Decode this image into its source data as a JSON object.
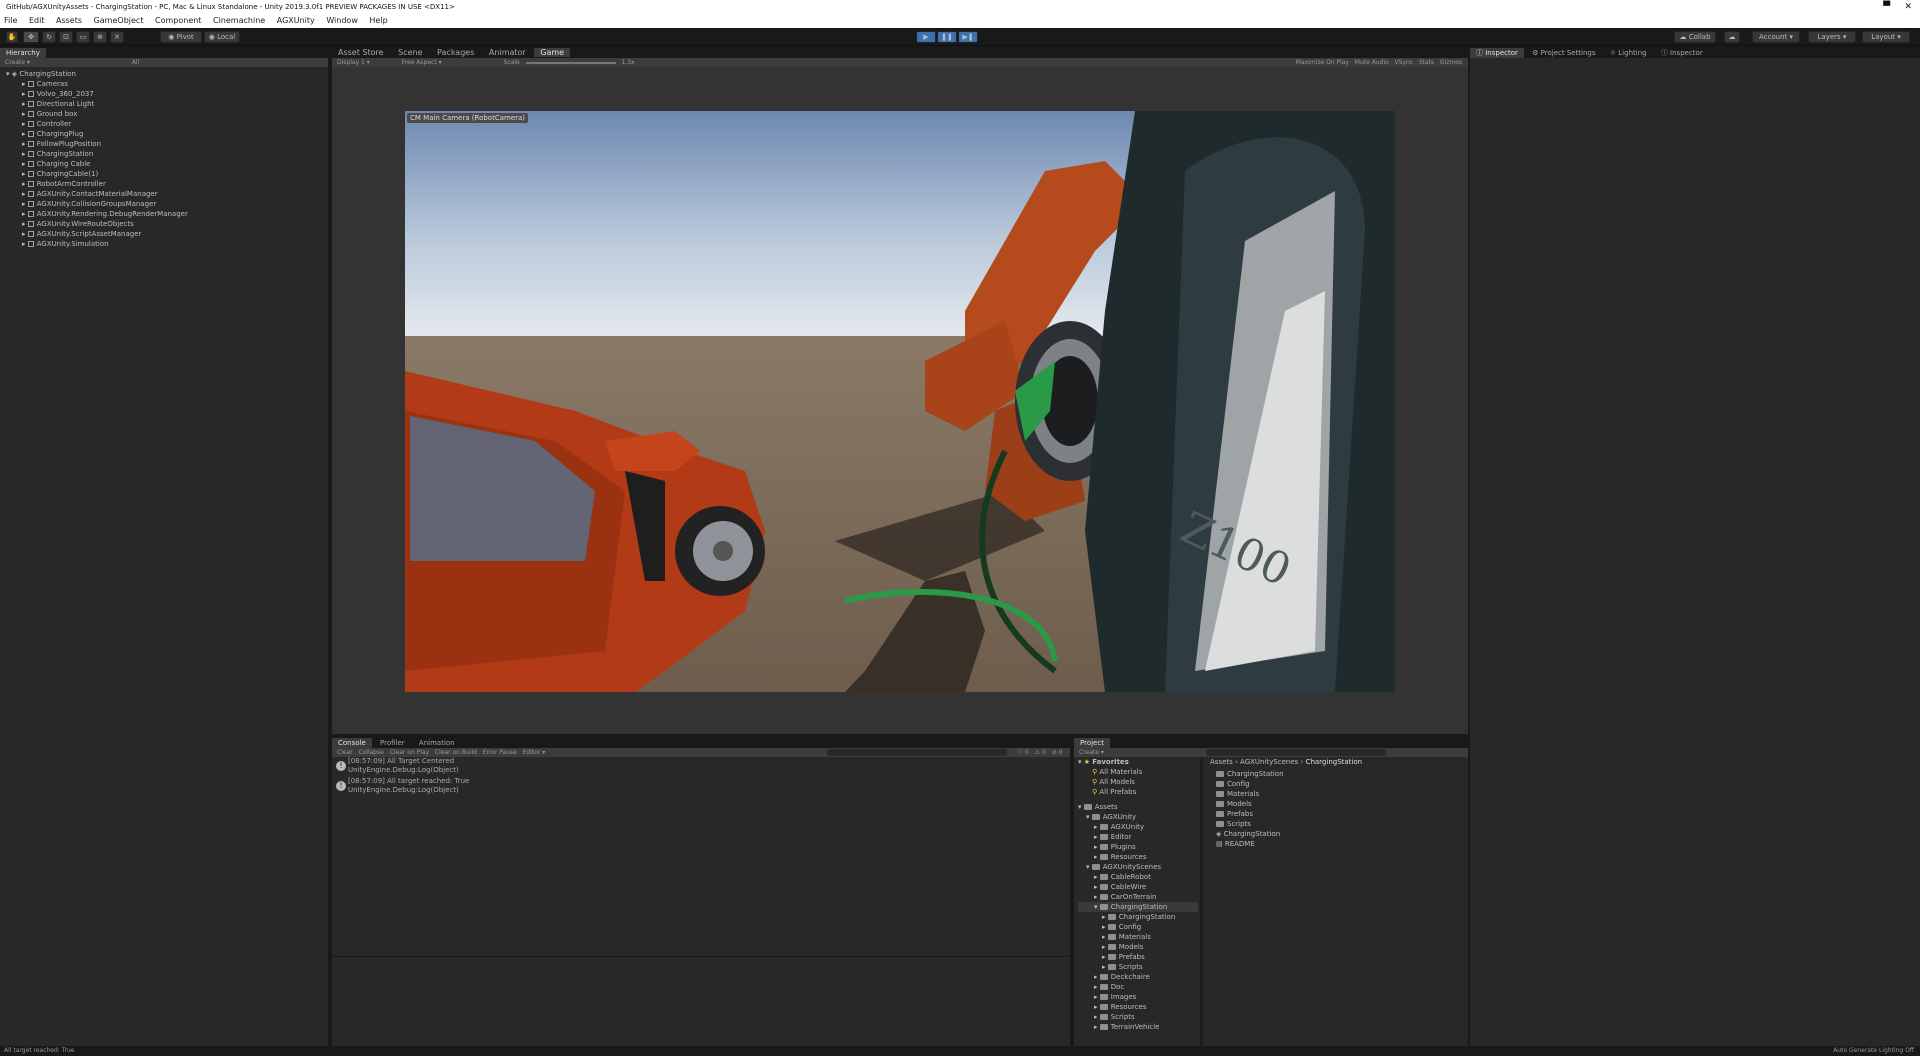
{
  "window": {
    "title": "GitHub/AGXUnityAssets - ChargingStation - PC, Mac & Linux Standalone - Unity 2019.3.0f1 PREVIEW PACKAGES IN USE <DX11>"
  },
  "menu": [
    "File",
    "Edit",
    "Assets",
    "GameObject",
    "Component",
    "Cinemachine",
    "AGXUnity",
    "Window",
    "Help"
  ],
  "toolbar": {
    "pivot": "Pivot",
    "local": "Local",
    "collab": "Collab",
    "account": "Account",
    "layers": "Layers",
    "layout": "Layout"
  },
  "hierarchy": {
    "tab": "Hierarchy",
    "create": "Create",
    "search_placeholder": "All",
    "scene": "ChargingStation",
    "items": [
      "Cameras",
      "Volvo_360_2037",
      "Directional Light",
      "Ground box",
      "Controller",
      "ChargingPlug",
      "FollowPlugPosition",
      "ChargingStation",
      "Charging Cable",
      "ChargingCable(1)",
      "RobotArmController",
      "AGXUnity.ContactMaterialManager",
      "AGXUnity.CollisionGroupsManager",
      "AGXUnity.Rendering.DebugRenderManager",
      "AGXUnity.WireRouteObjects",
      "AGXUnity.ScriptAssetManager",
      "AGXUnity.Simulation"
    ]
  },
  "center_tabs": [
    "Asset Store",
    "Scene",
    "Packages",
    "Animator",
    "Game"
  ],
  "game_bar": {
    "display": "Display 1",
    "aspect": "Free Aspect",
    "scale_label": "Scale",
    "scale_value": "1.3x",
    "right": [
      "Maximize On Play",
      "Mute Audio",
      "VSync",
      "Stats",
      "Gizmos"
    ]
  },
  "camera_label": "CM Main Camera (RobotCamera)",
  "right_tabs": [
    "Inspector",
    "Project Settings",
    "Lighting",
    "Inspector"
  ],
  "console": {
    "tabs": [
      "Console",
      "Profiler",
      "Animation"
    ],
    "toolbar": [
      "Clear",
      "Collapse",
      "Clear on Play",
      "Clear on Build",
      "Error Pause",
      "Editor"
    ],
    "counts": [
      "0",
      "0",
      "0"
    ],
    "rows": [
      {
        "line1": "[08:57:09] All Target Centered",
        "line2": "UnityEngine.Debug:Log(Object)"
      },
      {
        "line1": "[08:57:09] All target reached: True",
        "line2": "UnityEngine.Debug:Log(Object)"
      }
    ]
  },
  "project": {
    "tab": "Project",
    "create": "Create",
    "favorites_label": "Favorites",
    "favorites": [
      "All Materials",
      "All Models",
      "All Prefabs"
    ],
    "assets_label": "Assets",
    "tree": [
      {
        "label": "AGXUnity",
        "depth": 1,
        "open": true
      },
      {
        "label": "AGXUnity",
        "depth": 2
      },
      {
        "label": "Editor",
        "depth": 2
      },
      {
        "label": "Plugins",
        "depth": 2
      },
      {
        "label": "Resources",
        "depth": 2
      },
      {
        "label": "AGXUnityScenes",
        "depth": 1,
        "open": true
      },
      {
        "label": "CableRobot",
        "depth": 2
      },
      {
        "label": "CableWire",
        "depth": 2
      },
      {
        "label": "CarOnTerrain",
        "depth": 2
      },
      {
        "label": "ChargingStation",
        "depth": 2,
        "open": true,
        "selected": true
      },
      {
        "label": "ChargingStation",
        "depth": 3
      },
      {
        "label": "Config",
        "depth": 3
      },
      {
        "label": "Materials",
        "depth": 3
      },
      {
        "label": "Models",
        "depth": 3
      },
      {
        "label": "Prefabs",
        "depth": 3
      },
      {
        "label": "Scripts",
        "depth": 3
      },
      {
        "label": "Deckchaire",
        "depth": 2
      },
      {
        "label": "Doc",
        "depth": 2
      },
      {
        "label": "Images",
        "depth": 2
      },
      {
        "label": "Resources",
        "depth": 2
      },
      {
        "label": "Scripts",
        "depth": 2
      },
      {
        "label": "TerrainVehicle",
        "depth": 2
      }
    ],
    "breadcrumb": [
      "Assets",
      "AGXUnityScenes",
      "ChargingStation"
    ],
    "files": [
      "ChargingStation",
      "Config",
      "Materials",
      "Models",
      "Prefabs",
      "Scripts",
      "ChargingStation",
      "README"
    ]
  },
  "status": {
    "left": "All target reached: True",
    "right": "Auto Generate Lighting Off"
  }
}
